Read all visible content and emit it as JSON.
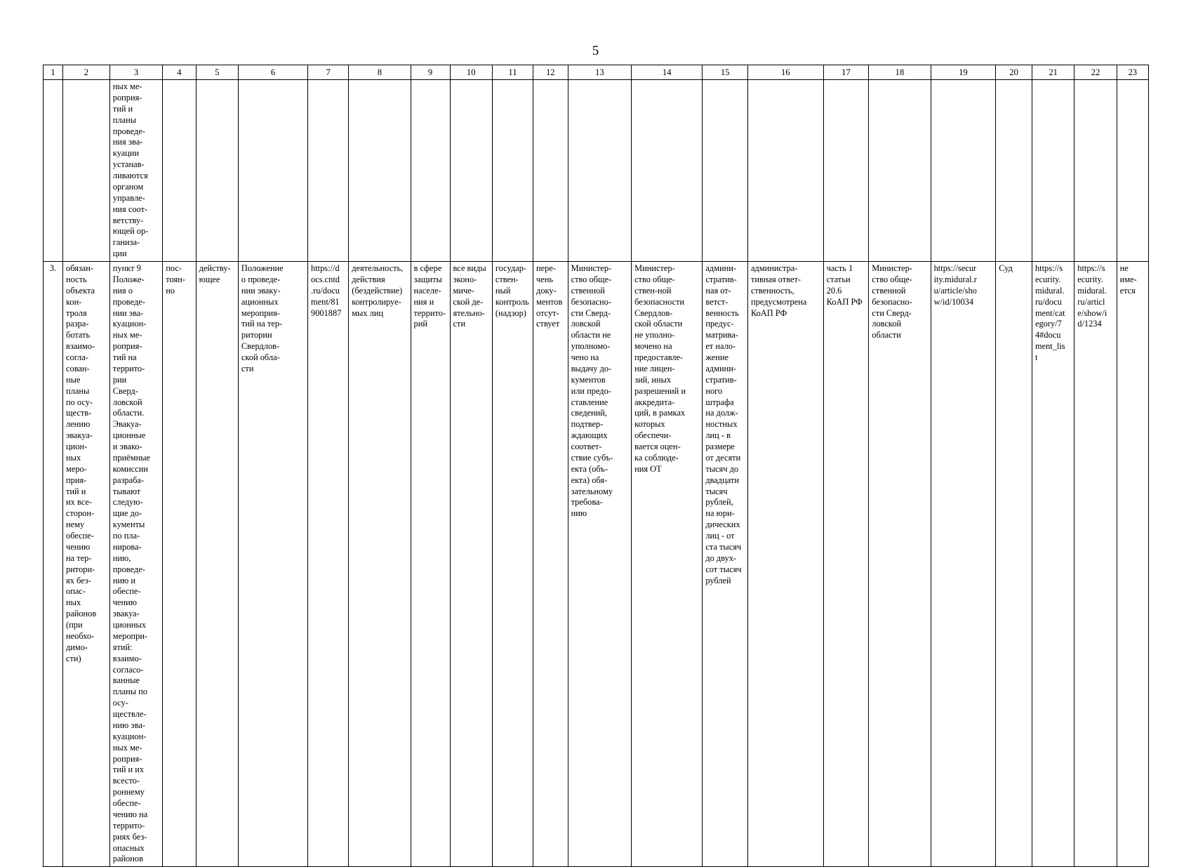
{
  "page": {
    "number": "5"
  },
  "table": {
    "column_headers": [
      "1",
      "2",
      "3",
      "4",
      "5",
      "6",
      "7",
      "8",
      "9",
      "10",
      "11",
      "12",
      "13",
      "14",
      "15",
      "16",
      "17",
      "18",
      "19",
      "20",
      "21",
      "22",
      "23"
    ],
    "rows": [
      {
        "name": "continuation-row",
        "cells": [
          "",
          "",
          "ных ме-\nроприя-\nтий и\nпланы\nпроведе-\nния эва-\nкуации\nустанав-\nливаются\nорганом\nуправле-\nния соот-\nветству-\nющей ор-\nганиза-\nции",
          "",
          "",
          "",
          "",
          "",
          "",
          "",
          "",
          "",
          "",
          "",
          "",
          "",
          "",
          "",
          "",
          "",
          "",
          "",
          ""
        ]
      },
      {
        "name": "main-row",
        "cells": [
          "3.",
          "обязан-\nность\nобъекта\nкон-\nтроля\nразра-\nботать\nвзаимо-\nсогла-\nсован-\nные\nпланы\nпо осу-\nществ-\nлению\nэвакуа-\nцион-\nных\nмеро-\nприя-\nтий и\nих все-\nсторон-\nнему\nобеспе-\nчению\nна тер-\nритори-\nях без-\nопас-\nных\nрайонов\n(при\nнеобхо-\nдимо-\nсти)",
          "пункт 9\nПоложе-\nния о\nпроведе-\nнии эва-\nкуацион-\nных ме-\nроприя-\nтий на\nтеррито-\nрии\nСверд-\nловской\nобласти.\nЭвакуа-\nционные\nи эвако-\nприёмные\nкомиссии\nразраба-\nтывают\nследую-\nщие до-\nкументы\nпо пла-\nнирова-\nнию,\nпроведе-\nнию и\nобеспе-\nчению\nэвакуа-\nционных\nмеропри-\nятий:\nвзаимо-\nсогласо-\nванные\nпланы по\nосу-\nществле-\nнию эва-\nкуацион-\nных ме-\nроприя-\nтий и их\nвсесто-\nроннему\nобеспе-\nчению на\nтеррито-\nриях без-\nопасных\nрайонов",
          "пос-\nтоян-\nно",
          "действу-\nющее",
          "Положение\nо проведе-\nнии эваку-\nационных\nмероприя-\nтий на тер-\nритории\nСвердлов-\nской обла-\nсти",
          "https://d\nocs.cntd\n.ru/docu\nment/81\n9001887",
          "деятельность,\nдействия\n(бездействие)\nконтролируе-\nмых лиц",
          "в сфере\nзащиты\nнаселе-\nния и\nтеррито-\nрий",
          "все виды\nэконо-\nмиче-\nской де-\nятельно-\nсти",
          "государ-\nствен-\nный\nконтроль\n(надзор)",
          "пере-\nчень\nдоку-\nментов\nотсут-\nствует",
          "Министер-\nство обще-\nственной\nбезопасно-\nсти Сверд-\nловской\nобласти не\nуполномо-\nчено на\nвыдачу до-\nкументов\nили предо-\nставление\nсведений,\nподтвер-\nждающих\nсоответ-\nствие субъ-\nекта (объ-\nекта) обя-\nзательному\nтребова-\nнию",
          "Министер-\nство обще-\nствен-ной\nбезопасности\nСвердлов-\nской области\nне уполно-\nмочено на\nпредоставле-\nние лицен-\nзий, иных\nразрешений и\nаккредита-\nций, в рамках\nкоторых\nобеспечи-\nвается оцен-\nка соблюде-\nния ОТ",
          "админи-\nстратив-\nная от-\nветст-\nвенность\nпредус-\nматрива-\nет нало-\nжение\nадмини-\nстратив-\nного\nштрафа\nна долж-\nностных\nлиц - в\nразмере\nот десяти\nтысяч до\nдвадцати\nтысяч\nрублей,\nна юри-\nдических\nлиц - от\nста тысяч\nдо двух-\nсот тысяч\nрублей",
          "администра-\nтивная ответ-\nственность,\nпредусмотрена\nКоАП РФ",
          "часть 1\nстатьи\n20.6\nКоАП РФ",
          "Министер-\nство обще-\nственной\nбезопасно-\nсти Сверд-\nловской\nобласти",
          "https://secur\nity.midural.r\nu/article/sho\nw/id/10034",
          "Суд",
          "https://s\necurity.\nmidural.\nru/docu\nment/cat\negory/7\n4#docu\nment_lis\nt",
          "https://s\necurity.\nmidural.\nru/articl\ne/show/i\nd/1234",
          "не\nиме-\nется"
        ]
      }
    ]
  }
}
